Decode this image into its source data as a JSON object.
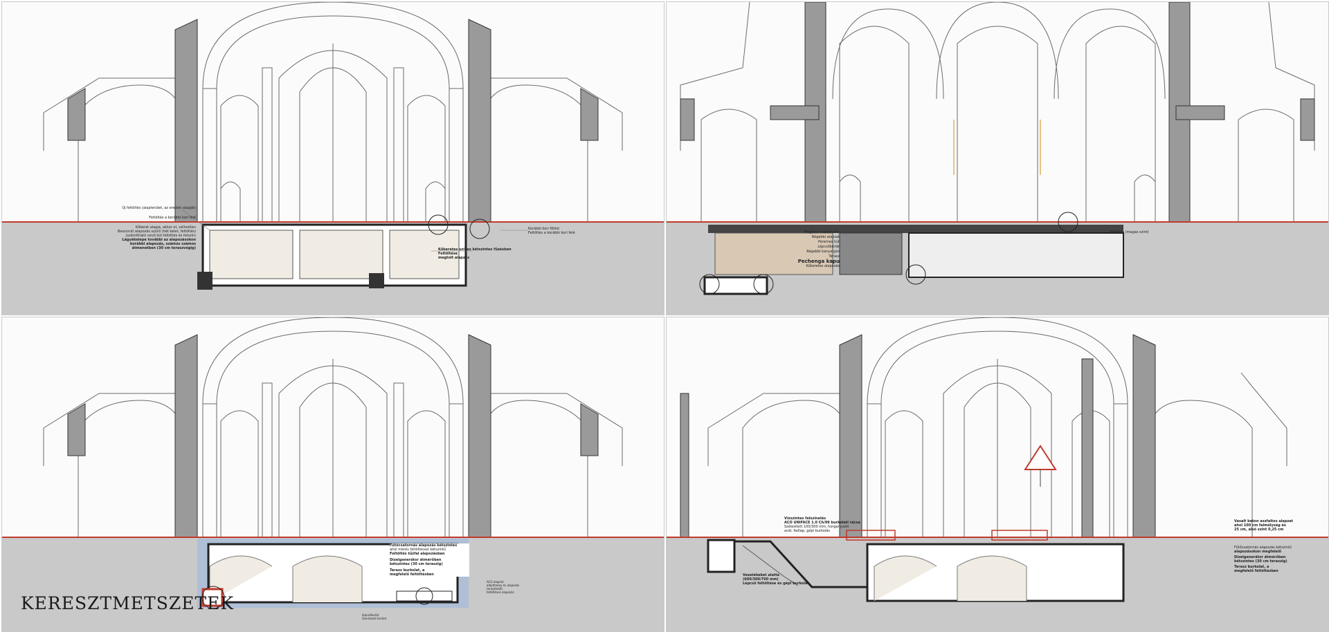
{
  "sheet": {
    "title": "KERESZTMETSZETEK"
  },
  "panels": [
    {
      "id": "section-a",
      "labels": [
        "Új feltöltés (alapterület, az eredeti alapját)",
        "Feltöltés a korábbi kori felé",
        "Korábbi kori fölöst",
        "Feltöltés a korábbi kori felé",
        "Kőkeret alapja, akkor el, vélhetően",
        "Beszorult alapozás szűrő (hét kelet, feltöltés)",
        "(számítható vevő kút feltöltés és felszín)",
        "Lágyékelepe további az alapozásokon",
        "korábbi alapozás, számos számos",
        "átmenetben (30 cm teraszvégig)",
        "Kőkeretes színes kétszintes fűzésben",
        "Feltöltése",
        "megtolt alapzás"
      ]
    },
    {
      "id": "section-b",
      "labels": [
        "Meglévő maradvány",
        "Régebbi alapzat",
        "Peremes kút",
        "Lépcsőkorlát",
        "Régebbi kanyargós",
        "Terasz",
        "Pechenga kapu",
        "Kőkeretes alapozás",
        "Feltöltés (magas szint)"
      ]
    },
    {
      "id": "section-c",
      "labels": [
        "Fűtőcsatornás alapozás kétszintes",
        "ahol mérés feltöltéssel kétszintű",
        "Feltöltés tűzfal alapozásban",
        "Dízelgenerátor átmérőben",
        "kétszintes (30 cm teraszig)",
        "Terasz burkolat, a",
        "megfelelő feltöltésben",
        "ACO alapzat",
        "alépítmény és alapozás",
        "teraszfedés",
        "feltöltéses alapozás",
        "lépcsőkorlát",
        "Szerkezeti terület"
      ]
    },
    {
      "id": "section-d",
      "labels": [
        "Vízszintes felszínelés",
        "ACO UNIFACE 1.0 Ch/99 burkolati rácsa",
        "Szélesített 100/300 mm, horganyzott",
        "acél, fedlap, gépi burkolás",
        "Vezetékeket alatta",
        "(600/300/700 mm)",
        "Lépcső feltöltése és gépi burkolás",
        "Vasalt beton aszfaltos alapzat",
        "ahol 100 cm falmélység és",
        "25 cm, alsó szint 0,25 cm",
        "Fűtőcsatornás alapozás kétszintű",
        "alapozásokon megfelelő",
        "Dízelgenerátor átmérőben",
        "kétszintes (30 cm teraszig)",
        "Terasz burkolat, a",
        "megfelelő feltöltésben"
      ]
    }
  ],
  "colors": {
    "line": "#4a4a4a",
    "ground": "#c8c8c8",
    "wall": "#9a9a9a",
    "cut": "#222222",
    "red": "#c0392b",
    "blue": "#aebfd6"
  }
}
